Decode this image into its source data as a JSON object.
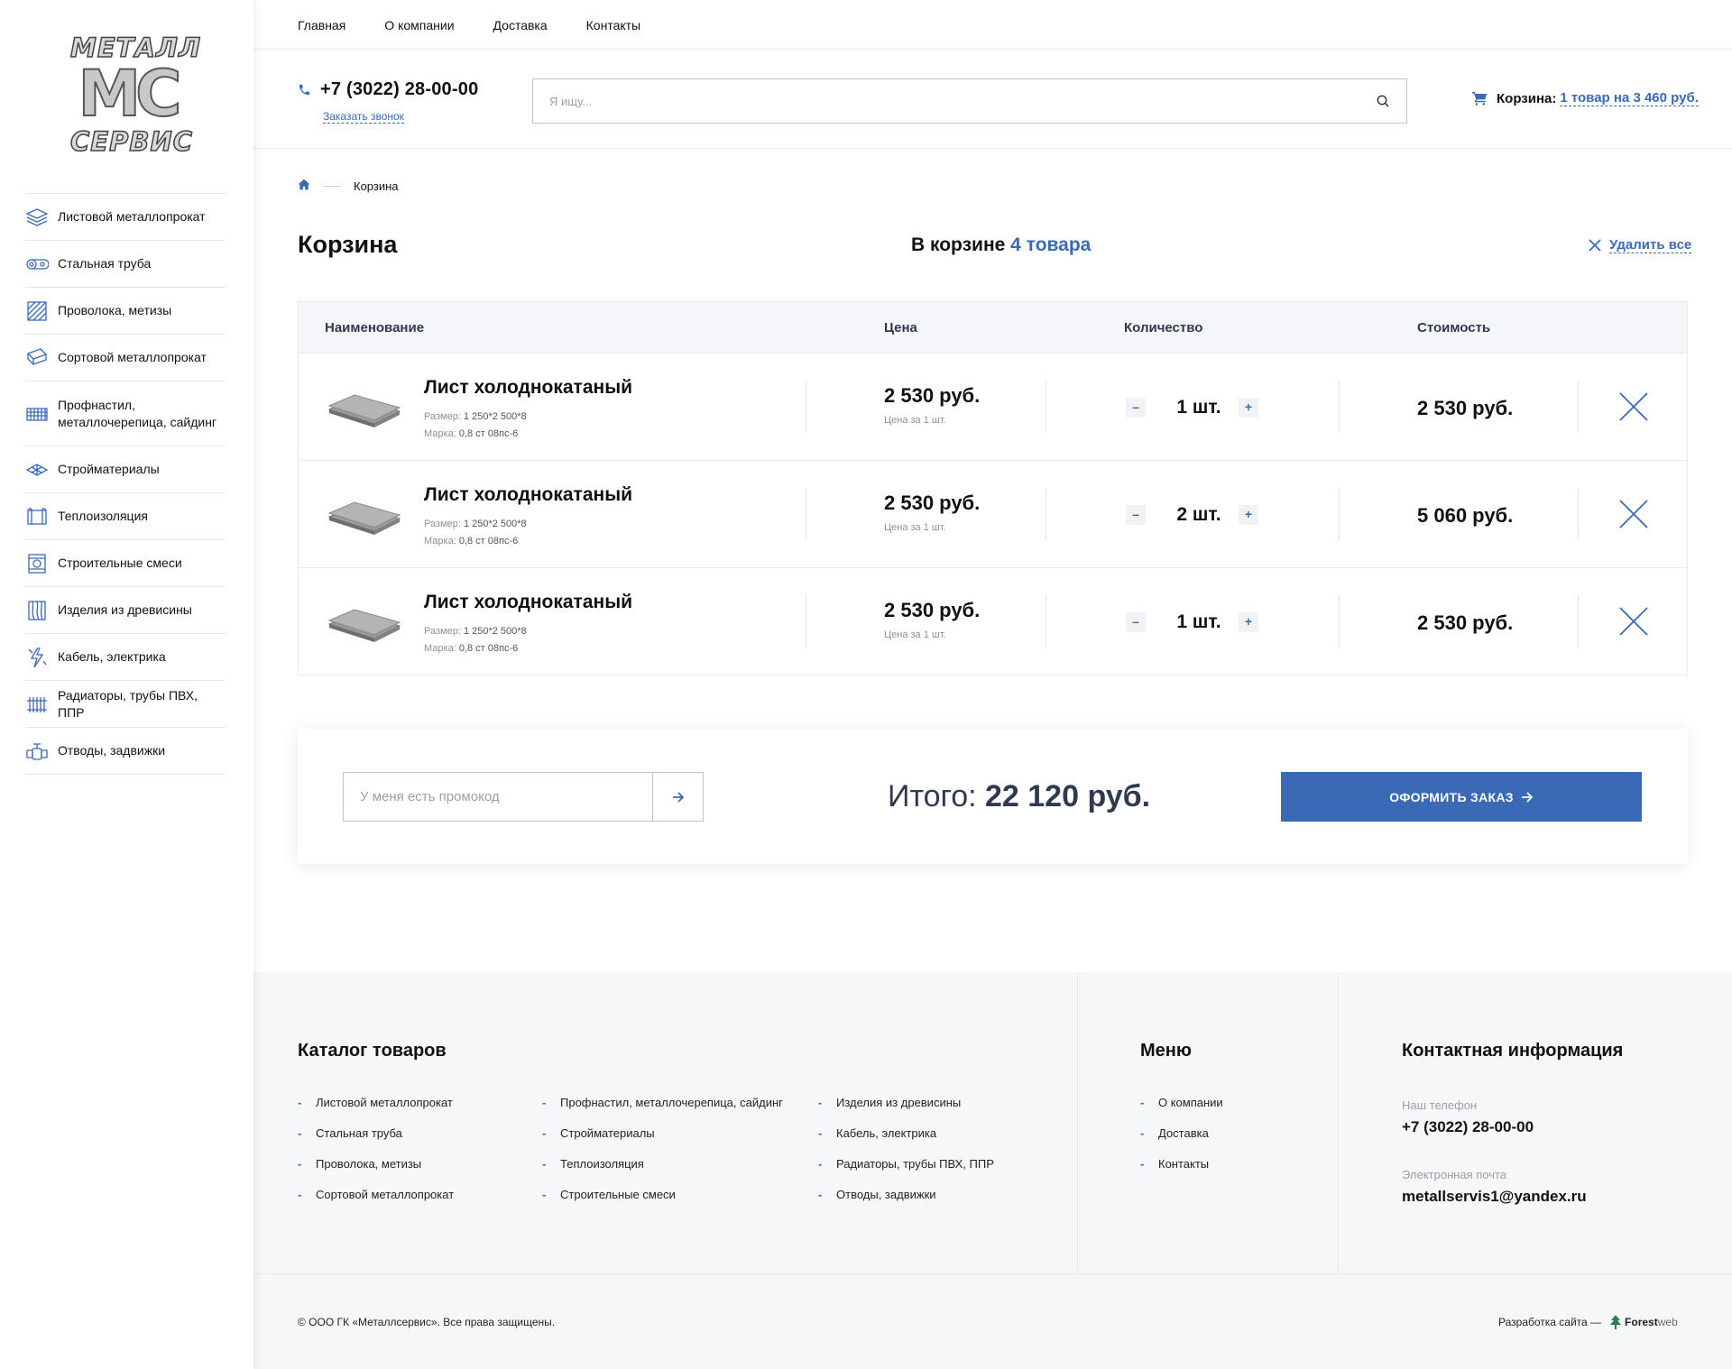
{
  "logo": {
    "top": "МЕТАЛЛ",
    "mid": "МС",
    "bottom": "СЕРВИС"
  },
  "sidebar": {
    "items": [
      {
        "label": "Листовой металлопрокат",
        "icon": "sheets-icon"
      },
      {
        "label": "Стальная труба",
        "icon": "pipes-icon"
      },
      {
        "label": "Проволока, метизы",
        "icon": "wire-icon"
      },
      {
        "label": "Сортовой металлопрокат",
        "icon": "profile-icon"
      },
      {
        "label": "Профнастил,\nметаллочерепица, сайдинг",
        "icon": "roofing-icon"
      },
      {
        "label": "Стройматериалы",
        "icon": "building-materials-icon"
      },
      {
        "label": "Теплоизоляция",
        "icon": "insulation-icon"
      },
      {
        "label": "Строительные смеси",
        "icon": "mix-bag-icon"
      },
      {
        "label": "Изделия из древисины",
        "icon": "wood-icon"
      },
      {
        "label": "Кабель, электрика",
        "icon": "cable-icon"
      },
      {
        "label": "Радиаторы, трубы ПВХ, ППР",
        "icon": "radiator-icon"
      },
      {
        "label": "Отводы, задвижки",
        "icon": "valve-icon"
      }
    ]
  },
  "topnav": [
    "Главная",
    "О компании",
    "Доставка",
    "Контакты"
  ],
  "header": {
    "phone": "+7 (3022) 28-00-00",
    "callback": "Заказать звонок",
    "search_placeholder": "Я ищу...",
    "cart_label": "Корзина:",
    "cart_link": "1 товар на 3 460 руб."
  },
  "breadcrumb": {
    "current": "Корзина"
  },
  "page": {
    "title": "Корзина",
    "in_cart_prefix": "В корзине",
    "in_cart_count": "4 товара",
    "delete_all": "Удалить все"
  },
  "table": {
    "headers": {
      "name": "Наименование",
      "price": "Цена",
      "qty": "Количество",
      "cost": "Стоимость"
    },
    "rows": [
      {
        "name": "Лист холоднокатаный",
        "size_label": "Размер:",
        "size": "1 250*2 500*8",
        "grade_label": "Марка:",
        "grade": "0,8 ст 08пс-6",
        "price": "2 530 руб.",
        "unit": "Цена за 1 шт.",
        "qty": "1 шт.",
        "total": "2 530 руб."
      },
      {
        "name": "Лист холоднокатаный",
        "size_label": "Размер:",
        "size": "1 250*2 500*8",
        "grade_label": "Марка:",
        "grade": "0,8 ст 08пс-6",
        "price": "2 530 руб.",
        "unit": "Цена за 1 шт.",
        "qty": "2 шт.",
        "total": "5 060 руб."
      },
      {
        "name": "Лист холоднокатаный",
        "size_label": "Размер:",
        "size": "1 250*2 500*8",
        "grade_label": "Марка:",
        "grade": "0,8 ст 08пс-6",
        "price": "2 530 руб.",
        "unit": "Цена за 1 шт.",
        "qty": "1 шт.",
        "total": "2 530 руб."
      }
    ],
    "minus": "–",
    "plus": "+"
  },
  "summary": {
    "promo_placeholder": "У меня есть промокод",
    "total_label": "Итого:",
    "total_value": "22 120 руб.",
    "checkout": "ОФОРМИТЬ ЗАКАЗ"
  },
  "footer": {
    "catalog_title": "Каталог товаров",
    "catalog_col1": [
      "Листовой металлопрокат",
      "Стальная труба",
      "Проволока, метизы",
      "Сортовой металлопрокат"
    ],
    "catalog_col2": [
      "Профнастил, металлочерепица, сайдинг",
      "Стройматериалы",
      "Теплоизоляция",
      "Строительные смеси"
    ],
    "catalog_col3": [
      "Изделия из древисины",
      "Кабель, электрика",
      "Радиаторы, трубы ПВХ, ППР",
      "Отводы, задвижки"
    ],
    "menu_title": "Меню",
    "menu": [
      "О компании",
      "Доставка",
      "Контакты"
    ],
    "contacts_title": "Контактная информация",
    "phone_label": "Наш телефон",
    "phone": "+7 (3022) 28-00-00",
    "email_label": "Электронная почта",
    "email": "metallservis1@yandex.ru",
    "copyright": "© ООО ГК «Металлсервис». Все права защищены.",
    "dev_label": "Разработка сайта —",
    "dev_brand1": "Forest",
    "dev_brand2": "web"
  },
  "colors": {
    "accent": "#3a6ab5",
    "footer_bg": "#f5f7f9",
    "table_head_bg": "#f4f6f9"
  }
}
